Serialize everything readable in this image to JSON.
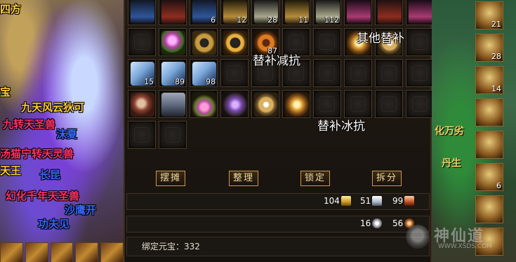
{
  "scene_left": {
    "texts": [
      {
        "id": "t0",
        "text": "四方",
        "color": "#ffd040"
      },
      {
        "id": "t1",
        "text": "九天风云狄可",
        "color": "#ffcc33"
      },
      {
        "id": "t2",
        "text": "九转天圣兽",
        "color": "#ff3366"
      },
      {
        "id": "t3",
        "text": "沫夏",
        "color": "#3366ff"
      },
      {
        "id": "t4",
        "text": "汤猫宁转天灵兽",
        "color": "#ff3366"
      },
      {
        "id": "t5",
        "text": "天王",
        "color": "#ffcc33"
      },
      {
        "id": "t6",
        "text": "长昆",
        "color": "#3366ff"
      },
      {
        "id": "t7",
        "text": "幻化千年天圣兽",
        "color": "#ff3366"
      },
      {
        "id": "t8",
        "text": "沙鹰开",
        "color": "#3366ff"
      },
      {
        "id": "t9",
        "text": "功夫见",
        "color": "#3366ff"
      },
      {
        "id": "t10",
        "text": "宝",
        "color": "#ffcc33"
      }
    ]
  },
  "scene_right": {
    "skills": [
      {
        "icon": "purple-gem-icon",
        "count": "21"
      },
      {
        "icon": "buddha-statue-icon",
        "count": "28"
      },
      {
        "icon": "buddha-statue-icon",
        "count": "14"
      },
      {
        "icon": "golden-crown-icon",
        "count": ""
      },
      {
        "icon": "golden-statue-icon",
        "count": ""
      },
      {
        "icon": "coffin-icon",
        "count": "6"
      },
      {
        "icon": "dragon-ring-icon",
        "count": ""
      },
      {
        "icon": "beast-head-icon",
        "count": ""
      }
    ],
    "texts": [
      {
        "id": "r1",
        "text": "化万劣"
      },
      {
        "id": "r2",
        "text": "丹生"
      }
    ]
  },
  "bag": {
    "top_row_counts": [
      "",
      "",
      "6",
      "12",
      "28",
      "11",
      "112",
      "",
      "",
      ""
    ],
    "items": [
      {
        "slot": 1,
        "icon": "green-gem-ring-icon",
        "cls": "gem-green",
        "count": ""
      },
      {
        "slot": 2,
        "icon": "gold-bracelet-icon",
        "cls": "bracelet",
        "count": ""
      },
      {
        "slot": 3,
        "icon": "gold-ring-icon",
        "cls": "ring-gold",
        "count": ""
      },
      {
        "slot": 4,
        "icon": "orange-ring-icon",
        "cls": "ring-orange",
        "count": "87"
      },
      {
        "slot": 7,
        "icon": "golden-armor-icon",
        "cls": "armor-gold",
        "count": ""
      },
      {
        "slot": 8,
        "icon": "silver-medal-icon",
        "cls": "medal",
        "count": ""
      },
      {
        "slot": 10,
        "icon": "scroll-icon",
        "cls": "scroll",
        "count": "15"
      },
      {
        "slot": 11,
        "icon": "scroll-icon",
        "cls": "scroll",
        "count": "89"
      },
      {
        "slot": 12,
        "icon": "scroll-icon",
        "cls": "scroll",
        "count": "98"
      },
      {
        "slot": 20,
        "icon": "gauntlet-icon",
        "cls": "glove",
        "count": ""
      },
      {
        "slot": 21,
        "icon": "boots-icon",
        "cls": "boots",
        "count": ""
      },
      {
        "slot": 22,
        "icon": "pink-pendant-icon",
        "cls": "pendant",
        "count": ""
      },
      {
        "slot": 23,
        "icon": "purple-charm-icon",
        "cls": "charm",
        "count": ""
      },
      {
        "slot": 24,
        "icon": "gold-medal-icon",
        "cls": "medal",
        "count": ""
      },
      {
        "slot": 25,
        "icon": "golden-armor-icon",
        "cls": "armor-gold",
        "count": ""
      }
    ],
    "total_slots": 32,
    "labels": {
      "other_substitute": "其他替补",
      "substitute_resist_reduce": "替补减抗",
      "substitute_ice_resist": "替补冰抗"
    },
    "buttons": {
      "stall": "摆摊",
      "sort": "整理",
      "lock": "锁定",
      "split": "拆分"
    },
    "money_row1": [
      {
        "value": "104",
        "icon": "gold-ingot-icon",
        "cls": "gold-ingot"
      },
      {
        "value": "51",
        "icon": "silver-book-icon",
        "cls": "silver-book"
      },
      {
        "value": "99",
        "icon": "red-book-icon",
        "cls": "red-book"
      }
    ],
    "money_row2": [
      {
        "value": "16",
        "icon": "silver-coin-icon",
        "cls": "coin-silver"
      },
      {
        "value": "56",
        "icon": "copper-coin-icon",
        "cls": "coin-copper"
      }
    ],
    "bound_yuanbao": "绑定元宝：332"
  },
  "watermark": {
    "text": "神仙道",
    "url": "WWW.XSDS.COM"
  }
}
